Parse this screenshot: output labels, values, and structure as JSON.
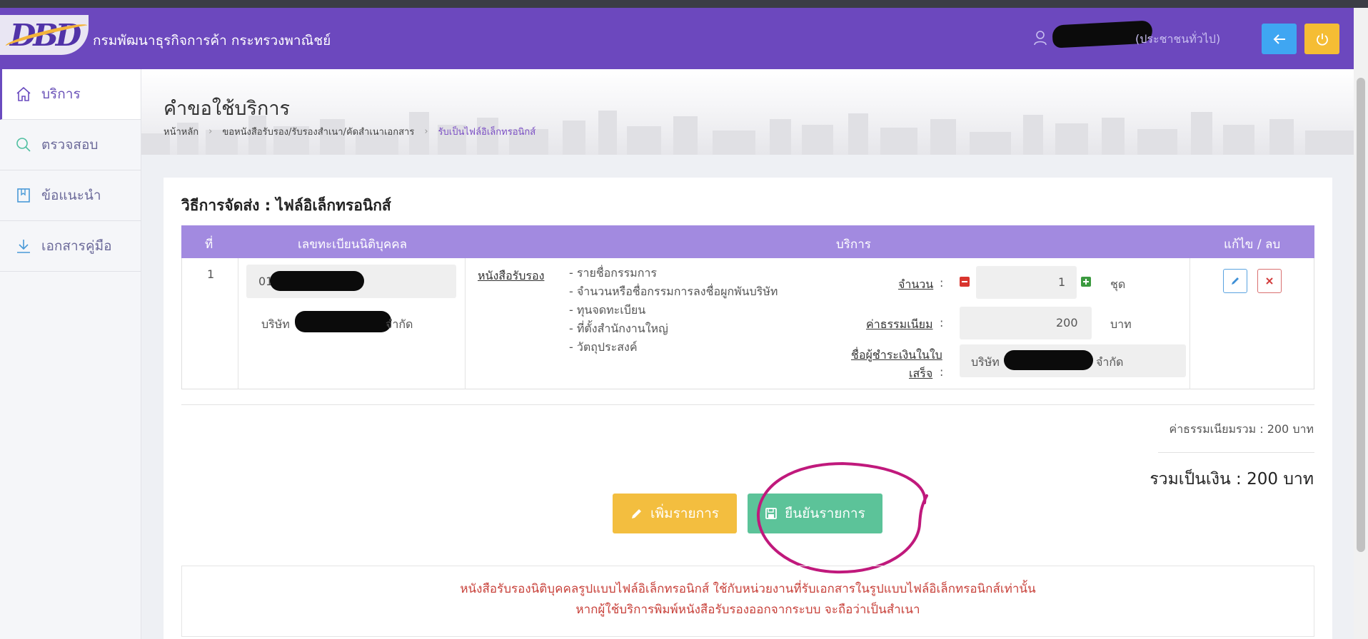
{
  "header": {
    "logo_text": "DBD",
    "department": "กรมพัฒนาธุรกิจการค้า กระทรวงพาณิชย์",
    "user_role": "(ประชาชนทั่วไป)",
    "back_icon": "arrow-left-icon",
    "logout_icon": "power-icon",
    "colors": {
      "header_bg": "#6c48be",
      "back_btn": "#3fa6f2",
      "power_btn": "#f5bd34"
    }
  },
  "sidebar": {
    "items": [
      {
        "label": "บริการ",
        "icon": "home-icon",
        "active": true
      },
      {
        "label": "ตรวจสอบ",
        "icon": "search-icon",
        "active": false
      },
      {
        "label": "ข้อแนะนำ",
        "icon": "book-icon",
        "active": false
      },
      {
        "label": "เอกสารคู่มือ",
        "icon": "download-icon",
        "active": false
      }
    ]
  },
  "page": {
    "title": "คำขอใช้บริการ",
    "breadcrumb": [
      "หน้าหลัก",
      "ขอหนังสือรับรอง/รับรองสำเนา/คัดสำเนาเอกสาร",
      "รับเป็นไฟล์อิเล็กทรอนิกส์"
    ]
  },
  "delivery": {
    "title": "วิธีการจัดส่ง : ไฟล์อิเล็กทรอนิกส์"
  },
  "table": {
    "headers": [
      "ที่",
      "เลขทะเบียนนิติบุคคล",
      "บริการ",
      "แก้ไข / ลบ"
    ],
    "row": {
      "no": "1",
      "reg_no_visible": "01",
      "company_prefix": "บริษัท",
      "company_suffix": "จำกัด",
      "service_link": "หนังสือรับรอง",
      "service_items": [
        "- รายชื่อกรรมการ",
        "- จำนวนหรือชื่อกรรมการลงชื่อผูกพันบริษัท",
        "- ทุนจดทะเบียน",
        "- ที่ตั้งสำนักงานใหญ่",
        "- วัตถุประสงค์"
      ],
      "qty_label": "จำนวน",
      "qty_value": "1",
      "qty_unit": "ชุด",
      "fee_label": "ค่าธรรมเนียม",
      "fee_value": "200",
      "fee_unit": "บาท",
      "payer_label_line1": "ชื่อผู้ชำระเงินในใบ",
      "payer_label_line2": "เสร็จ",
      "payer_prefix": "บริษัท",
      "payer_suffix": "จำกัด",
      "colon": ":"
    }
  },
  "totals": {
    "fee_total": "ค่าธรรมเนียมรวม : 200 บาท",
    "grand_total": "รวมเป็นเงิน : 200 บาท"
  },
  "actions": {
    "add_label": "เพิ่มรายการ",
    "confirm_label": "ยืนยันรายการ"
  },
  "notice": {
    "line1": "หนังสือรับรองนิติบุคคลรูปแบบไฟล์อิเล็กทรอนิกส์ ใช้กับหน่วยงานที่รับเอกสารในรูปแบบไฟล์อิเล็กทรอนิกส์เท่านั้น",
    "line2": "หากผู้ใช้บริการพิมพ์หนังสือรับรองออกจากระบบ จะถือว่าเป็นสำเนา"
  }
}
